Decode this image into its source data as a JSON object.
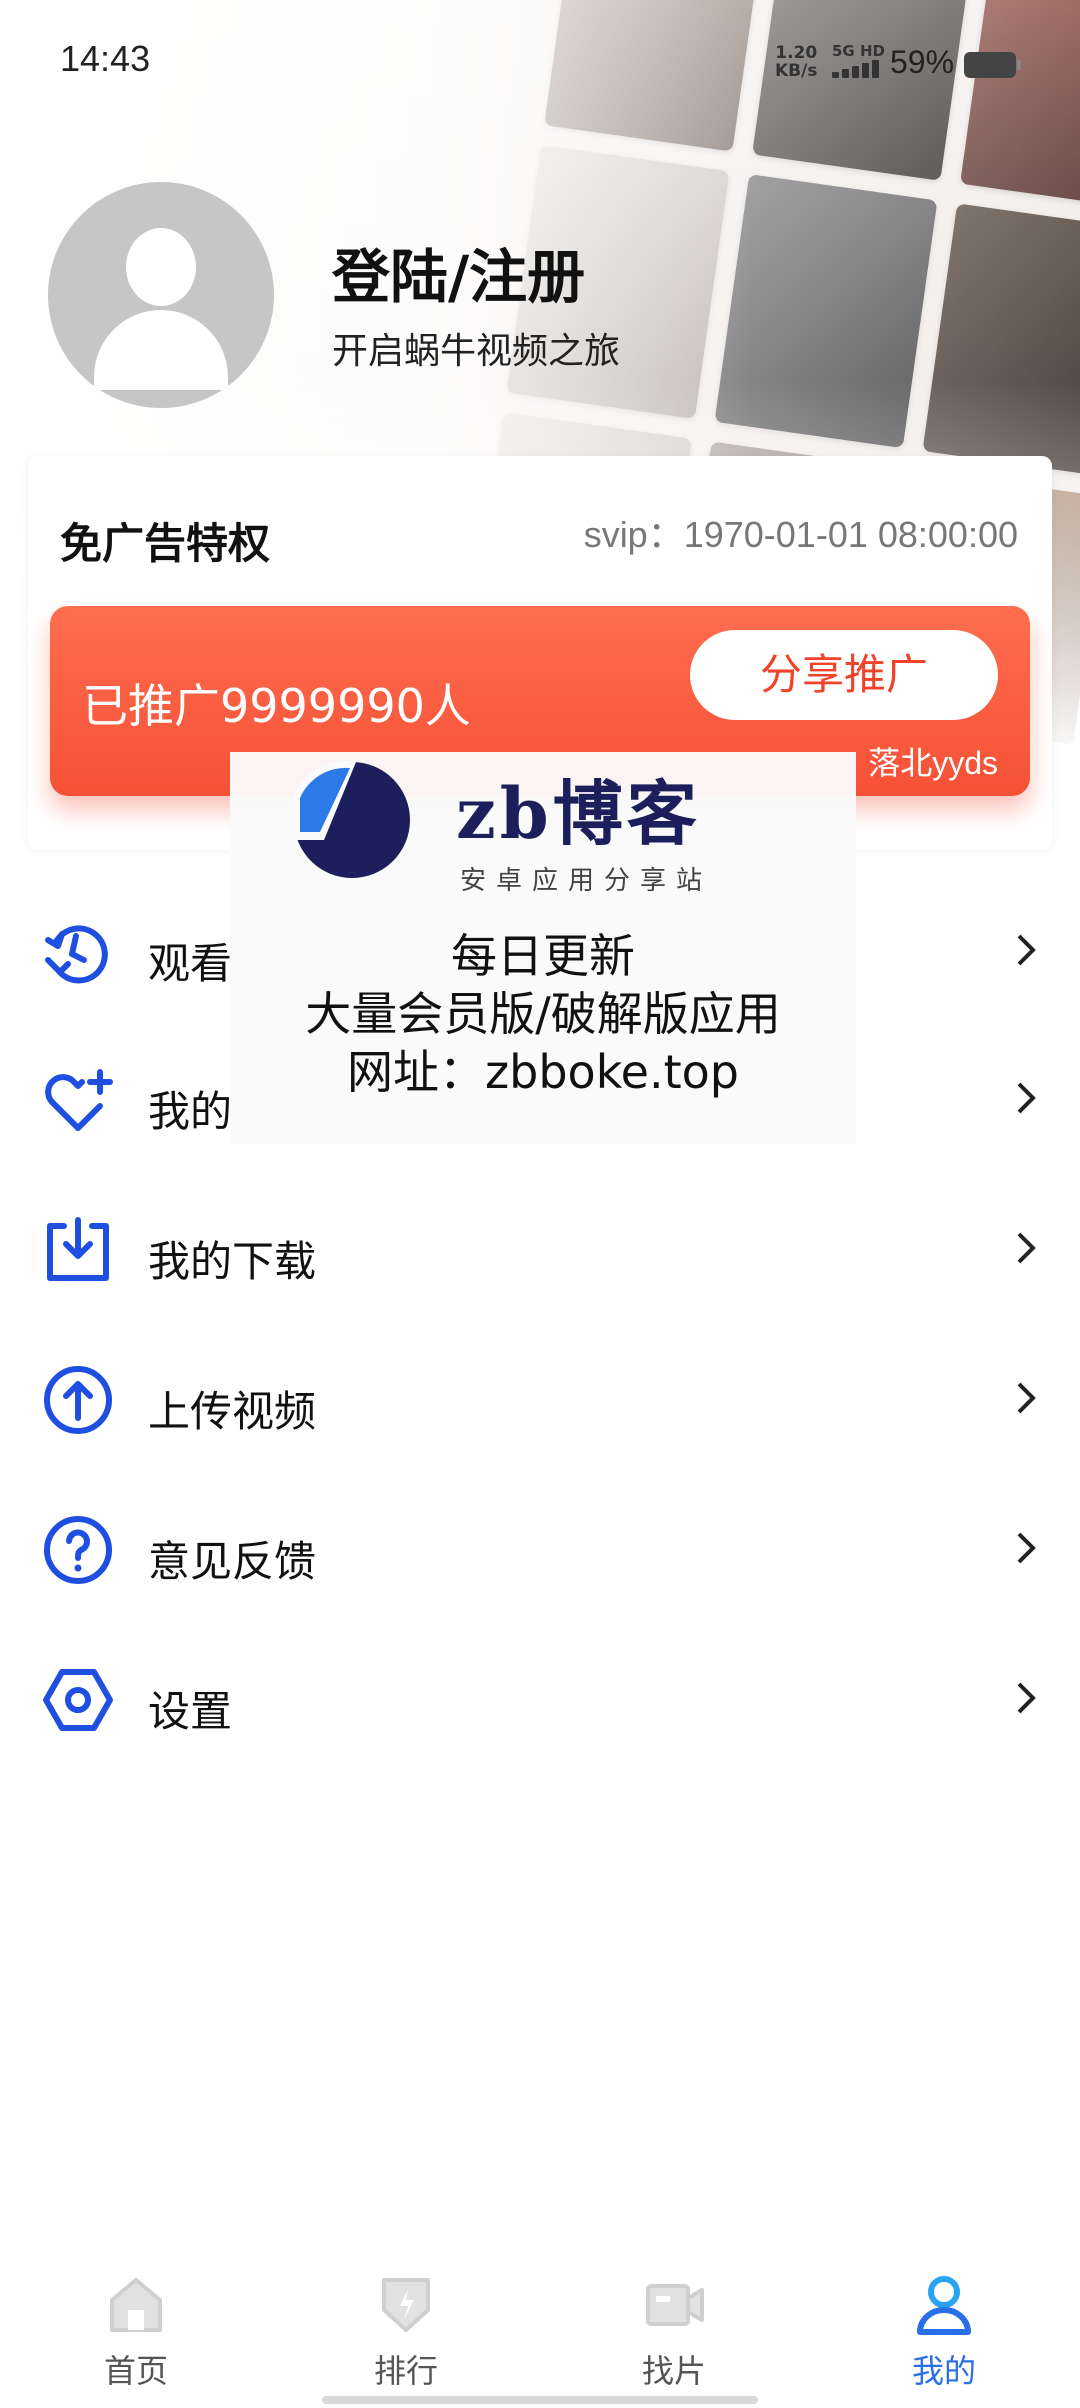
{
  "status_bar": {
    "time": "14:43",
    "net_speed_value": "1.20",
    "net_speed_unit": "KB/s",
    "network": "5G HD",
    "battery": "59%"
  },
  "profile": {
    "title": "登陆/注册",
    "subtitle": "开启蜗牛视频之旅"
  },
  "card": {
    "title": "免广告特权",
    "svip": "svip：1970-01-01 08:00:00",
    "promo_text": "已推广9999990人",
    "share_button": "分享推广",
    "credit": "落北yyds"
  },
  "menu": [
    {
      "label": "观看",
      "icon": "history-icon"
    },
    {
      "label": "我的",
      "icon": "favorite-heart-icon"
    },
    {
      "label": "我的下载",
      "icon": "download-icon"
    },
    {
      "label": "上传视频",
      "icon": "upload-icon"
    },
    {
      "label": "意见反馈",
      "icon": "feedback-question-icon"
    },
    {
      "label": "设置",
      "icon": "settings-icon"
    }
  ],
  "watermark": {
    "brand": "zb博客",
    "slogan": "安卓应用分享站",
    "line1": "每日更新",
    "line2": "大量会员版/破解版应用",
    "line3": "网址：zbboke.top"
  },
  "bottom_nav": [
    {
      "label": "首页",
      "icon": "home-icon",
      "active": false
    },
    {
      "label": "排行",
      "icon": "ranking-icon",
      "active": false
    },
    {
      "label": "找片",
      "icon": "video-camera-icon",
      "active": false
    },
    {
      "label": "我的",
      "icon": "person-icon",
      "active": true
    }
  ],
  "colors": {
    "accent_blue": "#2a6fe8",
    "menu_icon_blue": "#1f4fe0",
    "promo_red": "#f55136",
    "share_text_red": "#f0432a",
    "nav_inactive": "#cfcfcf"
  }
}
